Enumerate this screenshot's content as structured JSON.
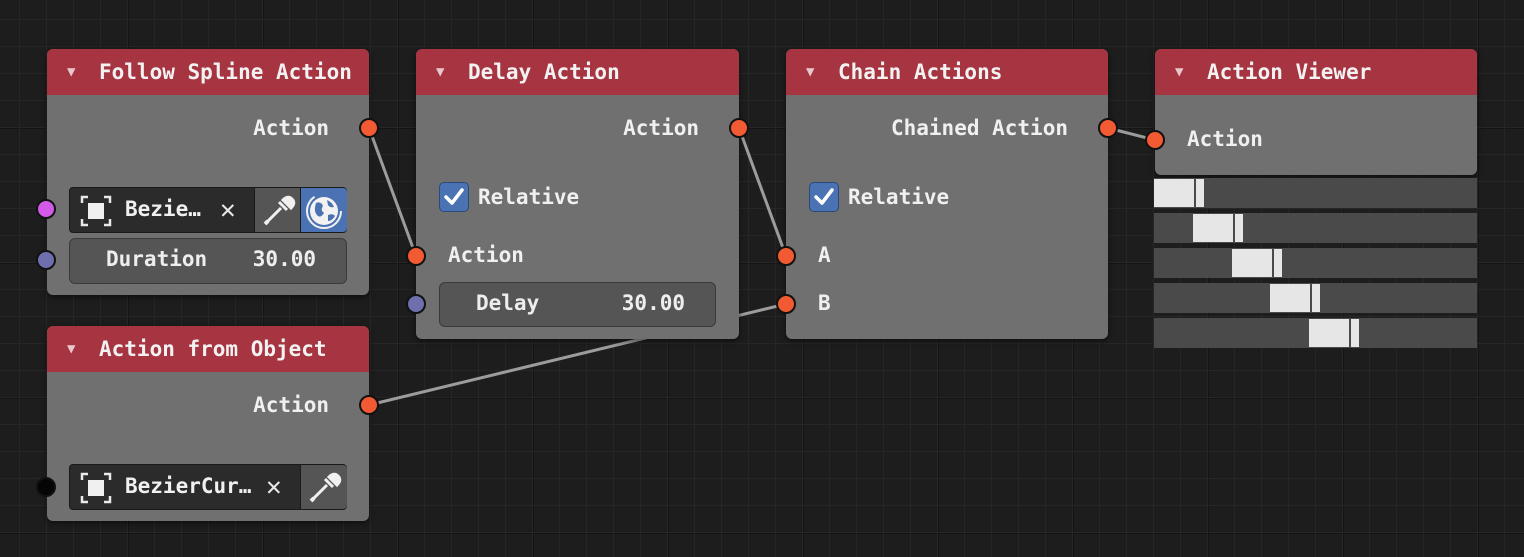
{
  "nodes": {
    "follow_spline": {
      "title": "Follow Spline Action",
      "output_label": "Action",
      "object_name": "Bezie…",
      "duration_label": "Duration",
      "duration_value": "30.00"
    },
    "action_from_object": {
      "title": "Action from Object",
      "output_label": "Action",
      "object_name": "BezierCur…"
    },
    "delay": {
      "title": "Delay Action",
      "output_label": "Action",
      "relative_label": "Relative",
      "relative_checked": true,
      "input_label": "Action",
      "delay_label": "Delay",
      "delay_value": "30.00"
    },
    "chain": {
      "title": "Chain Actions",
      "output_label": "Chained Action",
      "relative_label": "Relative",
      "relative_checked": true,
      "input_a_label": "A",
      "input_b_label": "B"
    },
    "viewer": {
      "title": "Action Viewer",
      "input_label": "Action"
    }
  },
  "viewer_timeline": {
    "rows": [
      {
        "start": 0.0,
        "end": 0.155
      },
      {
        "start": 0.12,
        "end": 0.275
      },
      {
        "start": 0.24,
        "end": 0.395
      },
      {
        "start": 0.36,
        "end": 0.515
      },
      {
        "start": 0.48,
        "end": 0.635
      }
    ]
  },
  "icons": {
    "collapse": "triangle-down-icon",
    "object": "object-icon",
    "clear": "clear-x-icon",
    "eyedropper": "eyedropper-icon",
    "world_space": "globe-icon",
    "check": "checkmark-icon"
  },
  "colors": {
    "header": "#a63441",
    "node_body": "#707070",
    "socket_action": "#f25a33",
    "socket_float": "#6f6fb0",
    "socket_object": "#d25ae6",
    "checkbox": "#4b73b3",
    "link": "#a0a0a0"
  }
}
